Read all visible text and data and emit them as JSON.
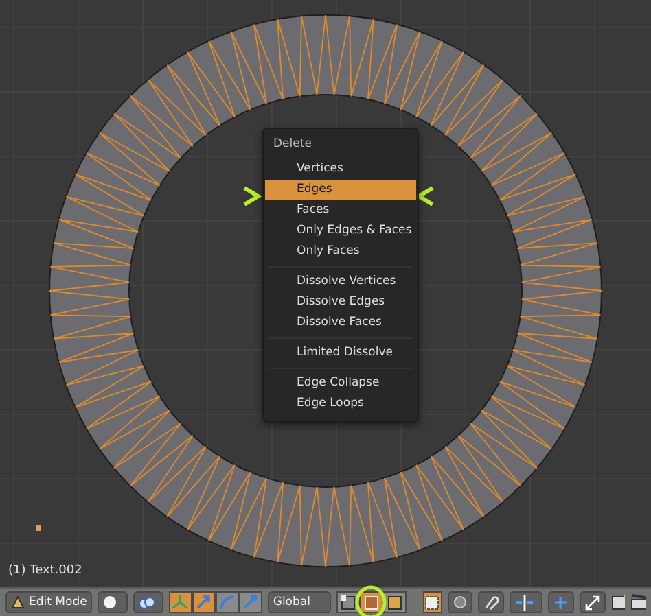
{
  "viewport": {
    "object_label": "(1) Text.002"
  },
  "menu": {
    "title": "Delete",
    "sections": [
      [
        {
          "label": "Vertices",
          "selected": false
        },
        {
          "label": "Edges",
          "selected": true
        },
        {
          "label": "Faces",
          "selected": false
        },
        {
          "label": "Only Edges & Faces",
          "selected": false
        },
        {
          "label": "Only Faces",
          "selected": false
        }
      ],
      [
        {
          "label": "Dissolve Vertices",
          "selected": false
        },
        {
          "label": "Dissolve Edges",
          "selected": false
        },
        {
          "label": "Dissolve Faces",
          "selected": false
        }
      ],
      [
        {
          "label": "Limited Dissolve",
          "selected": false
        }
      ],
      [
        {
          "label": "Edge Collapse",
          "selected": false
        },
        {
          "label": "Edge Loops",
          "selected": false
        }
      ]
    ]
  },
  "toolbar": {
    "mode": "Edit Mode",
    "orientation": "Global",
    "manipulators": [
      {
        "kind": "toggle",
        "selected": true
      },
      {
        "kind": "translate",
        "selected": true
      },
      {
        "kind": "rotate",
        "selected": false
      },
      {
        "kind": "scale",
        "selected": false
      }
    ],
    "select_modes": [
      {
        "kind": "vertex",
        "selected": false
      },
      {
        "kind": "edge",
        "selected": true
      },
      {
        "kind": "face",
        "selected": false
      }
    ],
    "occlude": {
      "selected": true
    }
  }
}
